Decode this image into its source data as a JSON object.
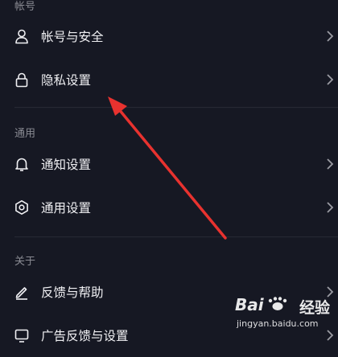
{
  "sections": {
    "account": {
      "header": "帐号"
    },
    "general": {
      "header": "通用"
    },
    "about": {
      "header": "关于"
    }
  },
  "items": {
    "account_security": {
      "label": "帐号与安全",
      "icon": "person-icon"
    },
    "privacy": {
      "label": "隐私设置",
      "icon": "lock-icon"
    },
    "notifications": {
      "label": "通知设置",
      "icon": "bell-icon"
    },
    "general_settings": {
      "label": "通用设置",
      "icon": "gear-icon"
    },
    "feedback_help": {
      "label": "反馈与帮助",
      "icon": "edit-icon"
    },
    "ad_feedback": {
      "label": "广告反馈与设置",
      "icon": "screen-icon"
    }
  },
  "watermark": {
    "brand": "经验",
    "url": "jingyan.baidu.com"
  },
  "colors": {
    "background": "#161823",
    "text": "#f0f0f3",
    "section_header": "#8a8b93",
    "annotation_arrow": "#e8322f"
  }
}
